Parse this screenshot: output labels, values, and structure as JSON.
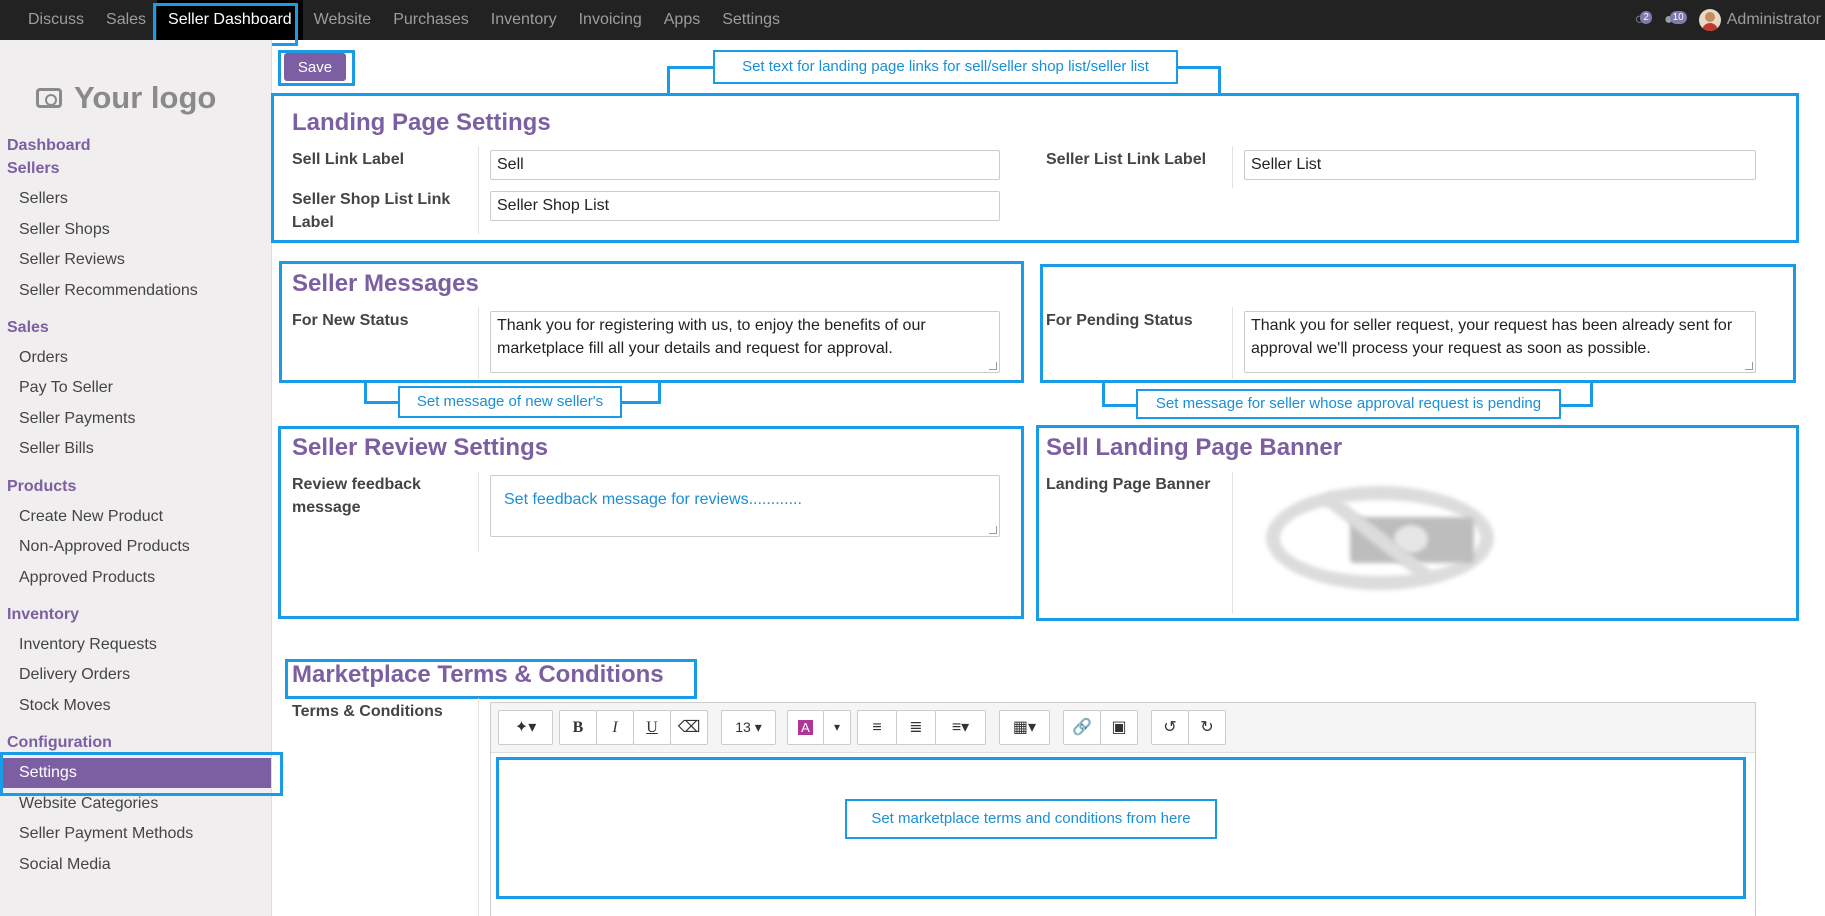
{
  "navbar": {
    "menu": [
      "Discuss",
      "Sales",
      "Seller Dashboard",
      "Website",
      "Purchases",
      "Inventory",
      "Invoicing",
      "Apps",
      "Settings"
    ],
    "chat_count": "2",
    "message_count": "10",
    "user": "Administrator"
  },
  "sidebar": {
    "logo_text": "Your logo",
    "headings": {
      "dashboard": "Dashboard",
      "sellers": "Sellers",
      "sales": "Sales",
      "products": "Products",
      "inventory": "Inventory",
      "configuration": "Configuration"
    },
    "sellers_items": [
      "Sellers",
      "Seller Shops",
      "Seller Reviews",
      "Seller Recommendations"
    ],
    "sales_items": [
      "Orders",
      "Pay To Seller",
      "Seller Payments",
      "Seller Bills"
    ],
    "products_items": [
      "Create New Product",
      "Non-Approved Products",
      "Approved Products"
    ],
    "inventory_items": [
      "Inventory Requests",
      "Delivery Orders",
      "Stock Moves"
    ],
    "configuration_items": [
      "Settings",
      "Website Categories",
      "Seller Payment Methods",
      "Social Media"
    ]
  },
  "main": {
    "save_label": "Save",
    "landing": {
      "title": "Landing Page Settings",
      "sell_label": "Sell Link Label",
      "sell_value": "Sell",
      "seller_list_label": "Seller List Link Label",
      "seller_list_value": "Seller List",
      "shop_list_label": "Seller Shop List Link Label",
      "shop_list_value": "Seller Shop List"
    },
    "messages": {
      "title": "Seller Messages",
      "new_label": "For New Status",
      "new_value": "Thank you for registering with us, to enjoy the benefits of our marketplace fill all your details and request for approval.",
      "pending_label": "For Pending Status",
      "pending_value": "Thank you for seller request, your request has been already sent for approval we'll process your request as soon as possible."
    },
    "review": {
      "title": "Seller Review Settings",
      "feedback_label": "Review feedback message"
    },
    "banner": {
      "title": "Sell Landing Page Banner",
      "label": "Landing Page Banner"
    },
    "terms": {
      "title": "Marketplace Terms & Conditions",
      "label": "Terms & Conditions",
      "font_size": "13"
    }
  },
  "annotations": {
    "landing_note": "Set text for landing page links for sell/seller shop list/seller list",
    "new_seller_note": "Set message of new seller's",
    "pending_note": "Set message for seller whose approval request is pending",
    "feedback_note": "Set feedback message for reviews............",
    "terms_note": "Set marketplace terms and conditions from here"
  },
  "colors": {
    "accent": "#7c5fa3",
    "annotation": "#1a9be8",
    "navbar": "#222222"
  }
}
